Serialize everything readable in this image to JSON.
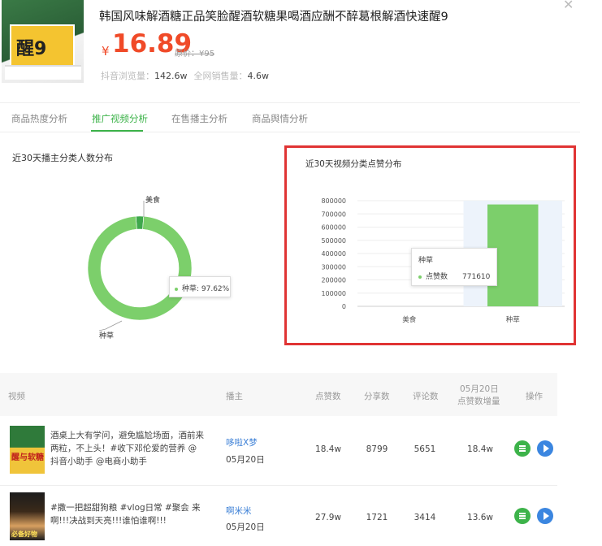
{
  "product": {
    "title": "韩国风味解酒糖正品笑脸醒酒软糖果喝酒应酬不醉葛根解酒快速醒9",
    "price_currency": "¥",
    "price": "16.89",
    "original_price": "原价：¥95",
    "stats": {
      "views_label": "抖音浏览量：",
      "views_value": "142.6w",
      "sales_label": "全网销售量：",
      "sales_value": "4.6w"
    },
    "thumb_text": "醒9",
    "close_icon": "close-icon"
  },
  "tabs": [
    {
      "label": "商品热度分析",
      "active": false
    },
    {
      "label": "推广视频分析",
      "active": true
    },
    {
      "label": "在售播主分析",
      "active": false
    },
    {
      "label": "商品舆情分析",
      "active": false
    }
  ],
  "colors": {
    "accent": "#3db34a",
    "price": "#f04a28",
    "highlight_border": "#e03434",
    "bar": "#7ccf6b",
    "link": "#3b7fd6"
  },
  "left_chart": {
    "title": "近30天播主分类人数分布",
    "tooltip": "种草: 97.62%"
  },
  "right_chart": {
    "title": "近30天视频分类点赞分布",
    "tooltip": {
      "title": "种草",
      "label": "点赞数",
      "value": "771610"
    }
  },
  "chart_data": [
    {
      "type": "pie",
      "title": "近30天播主分类人数分布",
      "categories": [
        "种草",
        "美食"
      ],
      "values": [
        97.62,
        2.38
      ],
      "unit": "%"
    },
    {
      "type": "bar",
      "title": "近30天视频分类点赞分布",
      "categories": [
        "美食",
        "种草"
      ],
      "series": [
        {
          "name": "点赞数",
          "values": [
            0,
            771610
          ]
        }
      ],
      "ylim": [
        0,
        800000
      ],
      "yticks": [
        "800000",
        "700000",
        "600000",
        "500000",
        "400000",
        "300000",
        "200000",
        "100000",
        "0"
      ],
      "grid": true
    }
  ],
  "table": {
    "headers": {
      "video": "视频",
      "author": "播主",
      "likes": "点赞数",
      "shares": "分享数",
      "comments": "评论数",
      "daily_line1": "05月20日",
      "daily_line2": "点赞数增量",
      "ops": "操作"
    },
    "rows": [
      {
        "thumb_text": "醒与软糖",
        "desc": "酒桌上大有学问，避免尴尬场面，酒前来两粒，不上头！#收下邓伦爱的营养 @抖音小助手 @电商小助手",
        "author": "哆啦X梦",
        "date": "05月20日",
        "likes": "18.4w",
        "shares": "8799",
        "comments": "5651",
        "daily": "18.4w"
      },
      {
        "thumb_text": "必备好物",
        "desc": "#撒一把超甜狗粮 #vlog日常 #聚会 来啊!!!决战到天亮!!!谁怕谁啊!!!",
        "author": "啊米米",
        "date": "05月20日",
        "likes": "27.9w",
        "shares": "1721",
        "comments": "3414",
        "daily": "13.6w"
      }
    ]
  }
}
